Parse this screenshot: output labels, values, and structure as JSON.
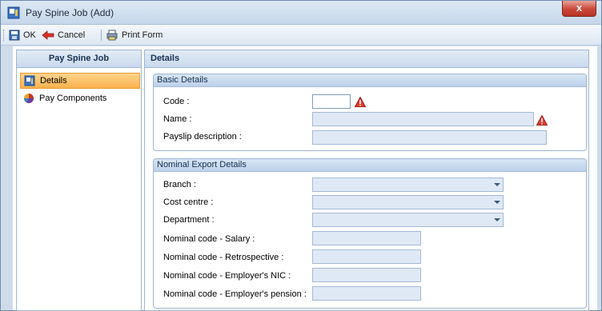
{
  "window": {
    "title": "Pay Spine Job (Add)",
    "close_label": "x"
  },
  "toolbar": {
    "ok_label": "OK",
    "cancel_label": "Cancel",
    "print_label": "Print Form"
  },
  "nav": {
    "header": "Pay Spine Job",
    "items": [
      {
        "label": "Details",
        "icon": "details-icon",
        "selected": true
      },
      {
        "label": "Pay Components",
        "icon": "pay-components-icon",
        "selected": false
      }
    ]
  },
  "main": {
    "header": "Details",
    "basic": {
      "title": "Basic Details",
      "code_label": "Code :",
      "code_value": "",
      "name_label": "Name :",
      "name_value": "",
      "payslip_label": "Payslip description :",
      "payslip_value": ""
    },
    "nominal": {
      "title": "Nominal Export Details",
      "branch_label": "Branch :",
      "cost_centre_label": "Cost centre :",
      "department_label": "Department :",
      "salary_label": "Nominal code - Salary :",
      "retro_label": "Nominal code - Retrospective :",
      "nic_label": "Nominal code - Employer's NIC :",
      "pension_label": "Nominal code - Employer's pension :"
    }
  },
  "colors": {
    "warning": "#e03c31",
    "selected_nav": "#f9b24f",
    "header": "#c9d9ec"
  }
}
